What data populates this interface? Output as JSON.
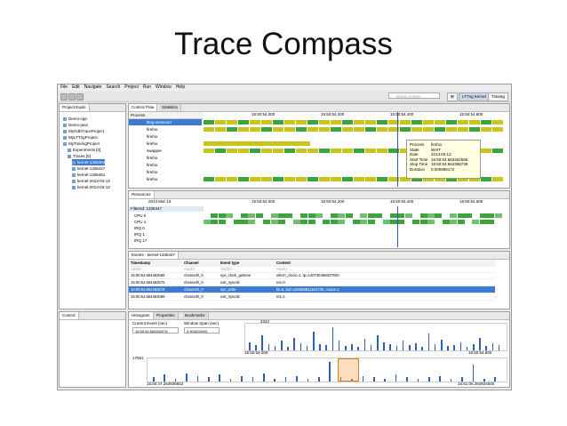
{
  "slide": {
    "title": "Trace Compass"
  },
  "menu": [
    "File",
    "Edit",
    "Navigate",
    "Search",
    "Project",
    "Run",
    "Window",
    "Help"
  ],
  "toolbar": {
    "quick_access_placeholder": "Quick Access",
    "perspectives": [
      "LTTng Kernel",
      "Tracing"
    ]
  },
  "project_explorer": {
    "tab": "Project Explo",
    "items": [
      {
        "label": "Demo-cpp",
        "indent": 0
      },
      {
        "label": "Demo-java",
        "indent": 0
      },
      {
        "label": "MyGdbTraceProject",
        "indent": 0
      },
      {
        "label": "MyLTTngProject",
        "indent": 0
      },
      {
        "label": "MyTracingProject",
        "indent": 0
      },
      {
        "label": "Experiments [0]",
        "indent": 1
      },
      {
        "label": "Traces [6]",
        "indent": 1
      },
      {
        "label": "kernel-1336464",
        "indent": 2,
        "selected": true
      },
      {
        "label": "kernel-1336447",
        "indent": 2
      },
      {
        "label": "kernel-1336451",
        "indent": 2
      },
      {
        "label": "kernel-2013-03-13",
        "indent": 2
      },
      {
        "label": "kernel-2013-03-13",
        "indent": 2
      }
    ]
  },
  "control_flow": {
    "tab_active": "Control Flow",
    "tab_inactive": "Statistics",
    "column_header": "Process",
    "time_ticks": [
      "15:50:54.000",
      "15:50:54.200",
      "15:50:54.400",
      "15:50:54.600",
      "15:50:54.800"
    ],
    "rows": [
      "lttng-sessiond",
      "firefox",
      "firefox",
      "firefox",
      "swapper",
      "firefox",
      "firefox",
      "firefox",
      "firefox"
    ],
    "tooltip": {
      "rows": [
        {
          "key": "Process",
          "value": "firefox"
        },
        {
          "key": "State",
          "value": "WAIT"
        },
        {
          "key": "Date",
          "value": "2013.03.13"
        },
        {
          "key": "Start Time",
          "value": "15:50:54.663462566"
        },
        {
          "key": "Stop Time",
          "value": "15:50:54.664358738"
        },
        {
          "key": "Duration",
          "value": "0.000896172"
        }
      ]
    }
  },
  "resources": {
    "tab": "Resources",
    "date_label": "2013 Mar 13",
    "time_ticks": [
      "15:50:54.000",
      "15:50:54.200",
      "15:50:54.400",
      "15:50:54.600",
      "15:50:54.800"
    ],
    "header": "Filtered: 1336447",
    "rows": [
      "CPU 0",
      "CPU 1",
      "IRQ 0",
      "IRQ 1",
      "IRQ 17"
    ]
  },
  "events": {
    "tab": "Events - kernel-1336447",
    "columns": [
      "Timestamp",
      "Channel",
      "Event type",
      "Content"
    ],
    "search_row": [
      "<srch>",
      "<srch>",
      "<srch>",
      "<srch>"
    ],
    "rows": [
      {
        "ts": "15:50:54.664462566",
        "channel": "channel0_0",
        "type": "sys_clock_gettime",
        "content": "which_clock=1, tp=140735468037920",
        "selected": false
      },
      {
        "ts": "15:50:54.664462575",
        "channel": "channel0_0",
        "type": "exit_syscall",
        "content": "ret=0",
        "selected": false
      },
      {
        "ts": "15:50:54.664462576",
        "channel": "channel0_0",
        "type": "sys_write",
        "content": "fd=5, buf=140468811161740, count=1",
        "selected": true
      },
      {
        "ts": "15:50:54.664462586",
        "channel": "channel0_0",
        "type": "exit_syscall",
        "content": "ret=1",
        "selected": false
      }
    ]
  },
  "control_view": {
    "tab": "Control"
  },
  "histogram": {
    "tabs": [
      "Histogram",
      "Properties",
      "Bookmarks"
    ],
    "current_event_label": "Current Event (sec)",
    "current_event_value": "15:50:54.664462576",
    "window_span_label": "Window Span (sec)",
    "window_span_value": "0.900000000",
    "top_ticks": [
      "15:50:54.000",
      "15:50:54.800"
    ],
    "bottom_ticks": [
      "15:50:47.264936652",
      "15:51:05.264934500"
    ],
    "top_count": "2342",
    "bottom_count": "17581",
    "bars": [
      8,
      5,
      14,
      6,
      4,
      9,
      3,
      12,
      7,
      4,
      18,
      6,
      5,
      22,
      9,
      4,
      6,
      3,
      11,
      5,
      14,
      8,
      6,
      4,
      9,
      5,
      7,
      3,
      16,
      6,
      10,
      4,
      5,
      8,
      3,
      6,
      12,
      4,
      7,
      5
    ],
    "bottom_bars": [
      3,
      5,
      2,
      6,
      4,
      3,
      5,
      2,
      4,
      3,
      6,
      2,
      3,
      4,
      2,
      3,
      14,
      3,
      2,
      4,
      3,
      2,
      5,
      3,
      2,
      3,
      4,
      2,
      3,
      12,
      2,
      3
    ]
  },
  "colors": {
    "running": "#3da33d",
    "wait": "#c9c51a",
    "selection": "#3d7bd1",
    "histogram_bar": "#2f5fb3"
  }
}
